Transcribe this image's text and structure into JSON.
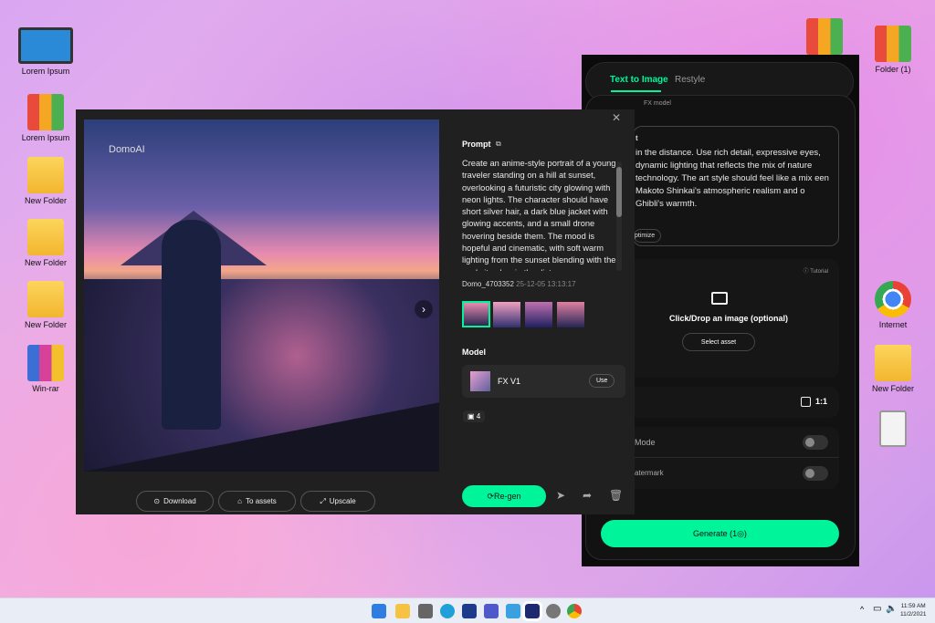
{
  "desktop": {
    "left_icons": [
      "Lorem Ipsum",
      "Lorem Ipsum",
      "New Folder",
      "New Folder",
      "New Folder",
      "Win-rar"
    ],
    "right_icons": [
      "Folder (1)",
      "Internet",
      "New Folder"
    ]
  },
  "panel": {
    "tabs": [
      "Text to Image",
      "Restyle"
    ],
    "model_tag": "FX model",
    "prompt_label": "t",
    "prompt_text": "in the distance. Use rich detail, expressive eyes, dynamic lighting that reflects the mix of nature technology. The art style should feel like a mix een Makoto Shinkai's atmospheric realism and o Ghibli's warmth.",
    "optimize": "ptimize",
    "tutorial": "Tutorial",
    "drop_text": "Click/Drop an image (optional)",
    "select_asset": "Select asset",
    "ratio": "1:1",
    "mode_label": "Mode",
    "watermark_label": "atermark",
    "generate": "Generate (1◎)",
    "accent": "#00f59b"
  },
  "modal": {
    "watermark": "DomoAI",
    "prompt_title": "Prompt",
    "prompt_text": "Create an anime-style portrait of a young traveler standing on a hill at sunset, overlooking a futuristic city glowing with neon lights. The character should have short silver hair, a dark blue jacket with glowing accents, and a small drone hovering beside them. The mood is hopeful and cinematic, with soft warm lighting from the sunset blending with the cool city glow in the distance.",
    "id": "Domo_4703352",
    "timestamp": "25-12-05 13:13:17",
    "model_title": "Model",
    "model_name": "FX V1",
    "use": "Use",
    "image_count": "4",
    "download": "Download",
    "to_assets": "To assets",
    "upscale": "Upscale",
    "regen": "Re-gen"
  },
  "taskbar": {
    "time": "11:59 AM",
    "date": "11/2/2021"
  }
}
